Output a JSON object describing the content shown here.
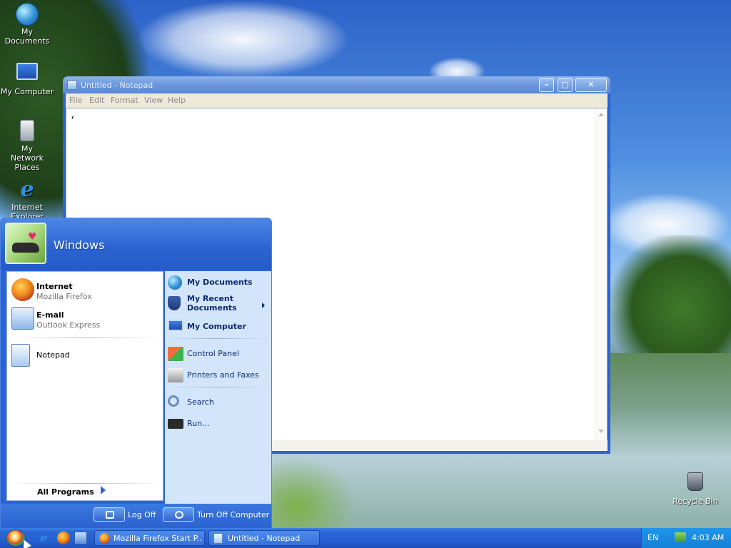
{
  "desktop": {
    "icons": [
      {
        "label": "My Documents"
      },
      {
        "label": "My Computer"
      },
      {
        "label": "My Network Places"
      },
      {
        "label": "Internet Explorer"
      },
      {
        "label": "Recycle Bin"
      }
    ]
  },
  "notepad": {
    "title": "Untitled - Notepad",
    "menu": [
      "File",
      "Edit",
      "Format",
      "View",
      "Help"
    ],
    "content": ",",
    "buttons": {
      "minimize": "–",
      "maximize": "□",
      "close": "✕"
    }
  },
  "start_menu": {
    "username": "Windows",
    "pinned": [
      {
        "title": "Internet",
        "subtitle": "Mozilla Firefox"
      },
      {
        "title": "E-mail",
        "subtitle": "Outlook Express"
      }
    ],
    "recent": [
      {
        "title": "Notepad"
      }
    ],
    "all_programs": "All Programs",
    "right": [
      {
        "label": "My Documents"
      },
      {
        "label": "My Recent Documents"
      },
      {
        "label": "My Computer"
      },
      {
        "label": "Control Panel"
      },
      {
        "label": "Printers and Faxes"
      },
      {
        "label": "Search"
      },
      {
        "label": "Run..."
      }
    ],
    "footer": {
      "log_off": "Log Off",
      "turn_off": "Turn Off Computer"
    }
  },
  "taskbar": {
    "tasks": [
      {
        "label": "Mozilla Firefox Start P..."
      },
      {
        "label": "Untitled - Notepad"
      }
    ],
    "tray": {
      "language": "EN",
      "clock": "4:03 AM"
    }
  }
}
